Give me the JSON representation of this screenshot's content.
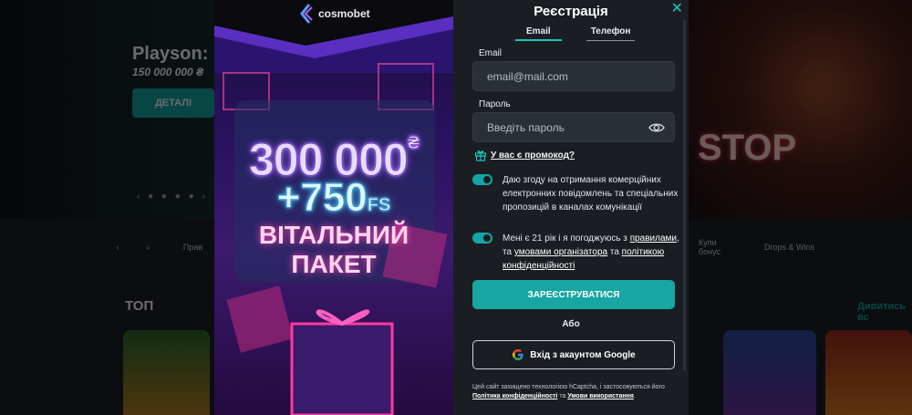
{
  "background": {
    "hero_title": "Playson:",
    "hero_subtitle": "150 000 000 ₴",
    "hero_button": "ДЕТАЛІ",
    "hero_right_text": "STOP",
    "nav_left_chip": "Прав",
    "nav_chip_1": "Купи бонус",
    "nav_chip_2": "Drops & Wins",
    "top_label": "ТОП",
    "see_all": "Дивитись вс"
  },
  "promo": {
    "brand": "cosmobet",
    "amount": "300 000",
    "currency": "₴",
    "fs_amount": "+750",
    "fs_suffix": "FS",
    "welcome_line1": "ВІТАЛЬНИЙ",
    "welcome_line2": "ПАКЕТ"
  },
  "form": {
    "title": "Реєстрація",
    "tabs": [
      {
        "label": "Email",
        "active": true
      },
      {
        "label": "Телефон",
        "active": false
      }
    ],
    "email": {
      "label": "Email",
      "placeholder": "email@mail.com"
    },
    "password": {
      "label": "Пароль",
      "placeholder": "Введіть пароль"
    },
    "promo_code_link": "У вас є промокод?",
    "consent_marketing": "Даю згоду на отримання комерційних електронних повідомлень та спеціальних пропозицій в каналах комунікації",
    "consent_terms": {
      "prefix": "Мені є 21 рік і я погоджуюсь з",
      "rules": "правилами",
      "mid1": ", та",
      "organizer_terms": "умовами організатора",
      "mid2": "та",
      "privacy": "політикою конфіденційності"
    },
    "register_button": "ЗАРЕЄСТРУВАТИСЯ",
    "or_text": "Або",
    "google_button": "Вхід з акаунтом Google",
    "captcha": {
      "text": "Цей сайт захищено технологією hCaptcha, і застосовуються його",
      "privacy_link": "Політика конфіденційності",
      "and": "та",
      "terms_link": "Умови використання",
      "end": "."
    }
  },
  "colors": {
    "accent": "#17a6a2",
    "close": "#20c5bd",
    "panel": "#1a1e23",
    "input": "#2a2f35"
  }
}
